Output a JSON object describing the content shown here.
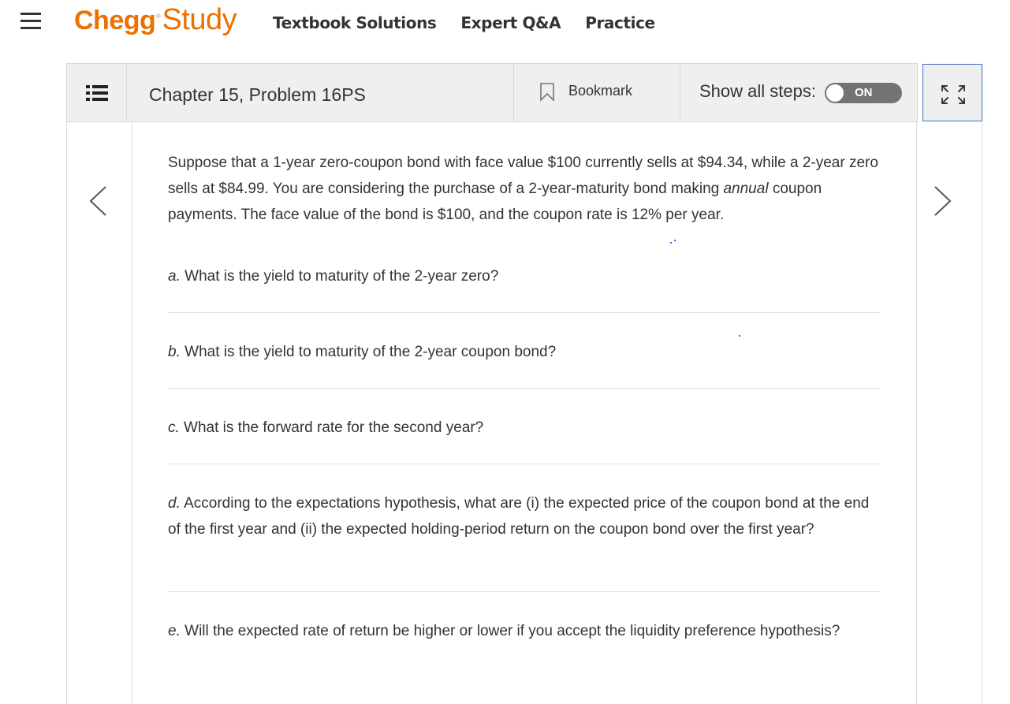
{
  "nav": {
    "brand_chegg": "Chegg",
    "brand_reg": "®",
    "brand_study": "Study",
    "links": [
      "Textbook Solutions",
      "Expert Q&A",
      "Practice"
    ]
  },
  "header": {
    "chapter_title": "Chapter 15, Problem 16PS",
    "bookmark_label": "Bookmark",
    "show_steps_label": "Show all steps:",
    "toggle_state": "ON"
  },
  "problem": {
    "intro_part1": "Suppose that a 1-year zero-coupon bond with face value $100 currently sells at $94.34, while a 2-year zero sells at $84.99. You are considering the purchase of a 2-year-maturity bond making ",
    "intro_emph": "annual",
    "intro_part2": " coupon payments. The face value of the bond is $100, and the coupon rate is 12% per year.",
    "questions": [
      {
        "label": "a.",
        "text": " What is the yield to maturity of the 2-year zero?"
      },
      {
        "label": "b.",
        "text": " What is the yield to maturity of the 2-year coupon bond?"
      },
      {
        "label": "c.",
        "text": " What is the forward rate for the second year?"
      },
      {
        "label": "d.",
        "text": " According to the expectations hypothesis, what are (i) the expected price of the coupon bond at the end of the first year and (ii) the expected holding-period return on the coupon bond over the first year?"
      },
      {
        "label": "e.",
        "text": " Will the expected rate of return be higher or lower if you accept the liquidity preference hypothesis?"
      }
    ]
  },
  "colors": {
    "brand": "#eb7100",
    "header_bg": "#efefef",
    "toggle_bg": "#737373",
    "focus_border": "#3d6fbf"
  },
  "icons": [
    "hamburger-menu-icon",
    "table-of-contents-icon",
    "bookmark-icon",
    "expand-icon",
    "chevron-left-icon",
    "chevron-right-icon"
  ]
}
